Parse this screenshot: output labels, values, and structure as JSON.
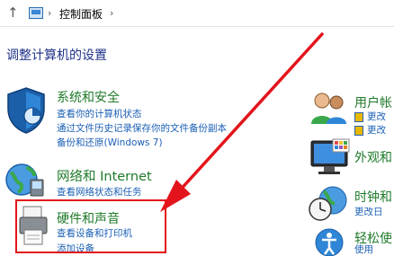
{
  "addressbar": {
    "up_icon": "up-arrow-icon",
    "location_icon": "control-panel-icon",
    "separator": "›",
    "crumb": "控制面板",
    "separator2": "›"
  },
  "page_title": "调整计算机的设置",
  "left_categories": [
    {
      "title": "系统和安全",
      "icon": "shield-icon",
      "links": [
        "查看你的计算机状态",
        "通过文件历史记录保存你的文件备份副本",
        "备份和还原(Windows 7)"
      ]
    },
    {
      "title": "网络和 Internet",
      "icon": "network-globe-icon",
      "links": [
        "查看网络状态和任务"
      ]
    },
    {
      "title": "硬件和声音",
      "icon": "printer-icon",
      "links": [
        "查看设备和打印机",
        "添加设备"
      ]
    }
  ],
  "right_categories": [
    {
      "title": "用户帐",
      "icon": "users-icon",
      "links": [
        "更改",
        "更改"
      ]
    },
    {
      "title": "外观和",
      "icon": "monitor-icon",
      "links": []
    },
    {
      "title": "时钟和",
      "icon": "clock-globe-icon",
      "links": [
        "更改日"
      ]
    },
    {
      "title": "轻松使",
      "icon": "accessibility-icon",
      "links": [
        "使用"
      ]
    }
  ],
  "annotation": {
    "highlight_color": "#e3141b"
  },
  "colors": {
    "category_title": "#1f7a2a",
    "link": "#1a5fb4",
    "heading": "#1e3287"
  }
}
